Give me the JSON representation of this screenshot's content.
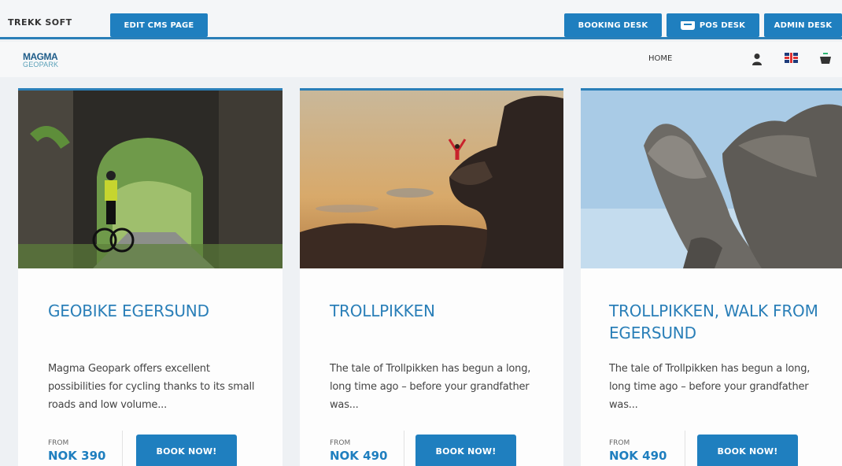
{
  "adminbar": {
    "logo": "TREKK SOFT",
    "edit_cms": "EDIT CMS PAGE",
    "booking_desk": "BOOKING DESK",
    "pos_desk": "POS DESK",
    "admin_desk": "ADMIN DESK"
  },
  "site": {
    "logo_line1": "MAGMA",
    "logo_line2": "GEOPARK",
    "nav_home": "HOME"
  },
  "colors": {
    "accent": "#1f7fbf"
  },
  "cards": [
    {
      "title": "GEOBIKE EGERSUND",
      "desc": "Magma Geopark offers excellent possibilities for cycling thanks to its small roads and low volume...",
      "from": "FROM",
      "price": "NOK 390",
      "button": "BOOK NOW!",
      "image": "cyclist-in-tunnel"
    },
    {
      "title": "TROLLPIKKEN",
      "desc": "The tale of Trollpikken  has begun a long, long time ago – before your grandfather was...",
      "from": "FROM",
      "price": "NOK 490",
      "button": "BOOK NOW!",
      "image": "person-on-rock-sunset"
    },
    {
      "title": "TROLLPIKKEN, WALK FROM EGERSUND",
      "desc": "The tale of Trollpikken has begun a long, long time ago – before your grandfather was...",
      "from": "FROM",
      "price": "NOK 490",
      "button": "BOOK NOW!",
      "image": "rock-formation-sky"
    }
  ]
}
